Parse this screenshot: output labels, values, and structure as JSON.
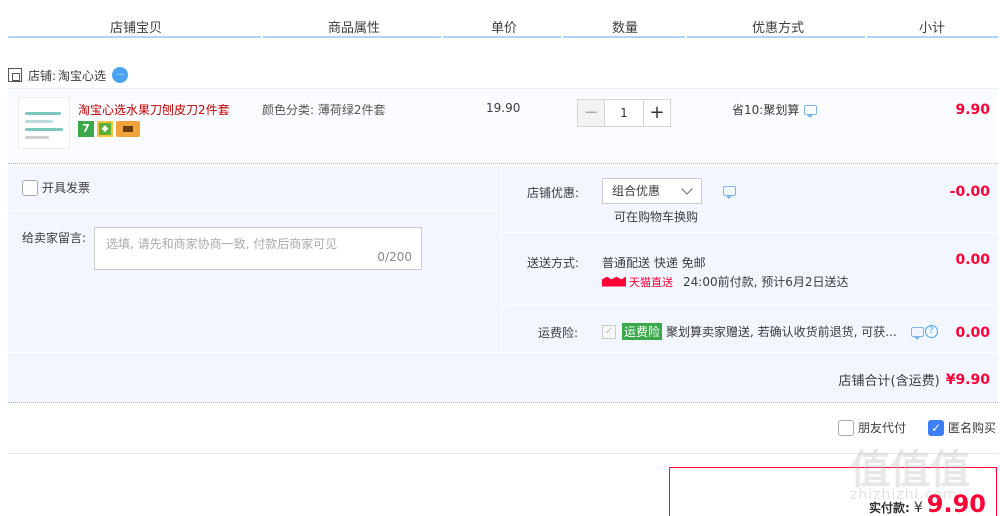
{
  "header": {
    "col_item": "店铺宝贝",
    "col_attr": "商品属性",
    "col_price": "单价",
    "col_qty": "数量",
    "col_promo": "优惠方式",
    "col_subtotal": "小计"
  },
  "shop": {
    "label": "店铺:",
    "name": "淘宝心选"
  },
  "item": {
    "title": "淘宝心选水果刀刨皮刀2件套",
    "badge_7": "7",
    "attr": "颜色分类: 薄荷绿2件套",
    "price": "19.90",
    "qty": "1",
    "qty_minus": "−",
    "qty_plus": "+",
    "promo": "省10:聚划算",
    "subtotal": "9.90"
  },
  "order": {
    "invoice_label": "开具发票",
    "memo_label": "给卖家留言:",
    "memo_placeholder": "选填, 请先和商家协商一致, 付款后商家可见",
    "memo_count": "0/200",
    "discount_label": "店铺优惠:",
    "discount_select": "组合优惠",
    "discount_hint": "可在购物车换购",
    "discount_value": "-0.00",
    "shipping_label": "送送方式:",
    "shipping_method": "普通配送 快递 免邮",
    "tmall_logo": "天猫直送",
    "shipping_eta": "24:00前付款, 预计6月2日送达",
    "shipping_fee": "0.00",
    "insurance_label": "运费险:",
    "insurance_badge": "运费险",
    "insurance_desc": "聚划算卖家赠送, 若确认收货前退货, 可获...",
    "insurance_fee": "0.00",
    "shop_total_label": "店铺合计(含运费)",
    "shop_total_value": "¥9.90"
  },
  "options": {
    "friend_pay": "朋友代付",
    "anonymous": "匿名购买",
    "anonymous_checked": true
  },
  "payment": {
    "label": "实付款:",
    "currency": "¥",
    "amount": "9.90"
  },
  "watermark": {
    "glyphs": "值值值",
    "domain": "zhizhizhi.com"
  },
  "colors": {
    "price_red": "#ff0036",
    "title_red": "#c40000",
    "panel_bg": "#f2f7ff",
    "accent_blue": "#3d7df5",
    "green_badge": "#3aa84b"
  },
  "icons": [
    "shop-icon",
    "wangwang-icon",
    "chat-icon",
    "chevron-down-icon",
    "help-icon",
    "checkbox-checked-icon"
  ]
}
